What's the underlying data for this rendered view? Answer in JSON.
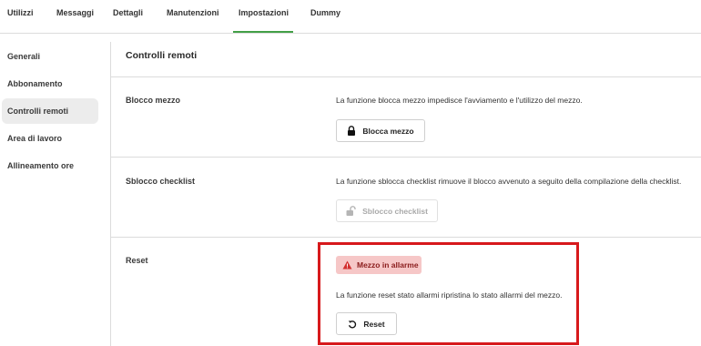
{
  "tabs": [
    {
      "label": "Utilizzi"
    },
    {
      "label": "Messaggi"
    },
    {
      "label": "Dettagli"
    },
    {
      "label": "Manutenzioni"
    },
    {
      "label": "Impostazioni"
    },
    {
      "label": "Dummy"
    }
  ],
  "active_tab": "Impostazioni",
  "sidebar": {
    "items": [
      {
        "label": "Generali"
      },
      {
        "label": "Abbonamento"
      },
      {
        "label": "Controlli remoti"
      },
      {
        "label": "Area di lavoro"
      },
      {
        "label": "Allineamento ore"
      }
    ],
    "active": "Controlli remoti"
  },
  "main": {
    "title": "Controlli remoti",
    "rows": [
      {
        "label": "Blocco mezzo",
        "description": "La funzione blocca mezzo impedisce l'avviamento e l'utilizzo del mezzo.",
        "button": "Blocca mezzo",
        "button_icon": "lock-icon"
      },
      {
        "label": "Sblocco checklist",
        "description": "La funzione sblocca checklist rimuove il blocco avvenuto a seguito della compilazione della checklist.",
        "button": "Sblocco checklist",
        "button_icon": "unlock-icon",
        "button_disabled": true
      },
      {
        "label": "Reset",
        "alert": "Mezzo in allarme",
        "alert_icon": "warning-icon",
        "description": "La funzione reset stato allarmi ripristina lo stato allarmi del mezzo.",
        "button": "Reset",
        "button_icon": "reset-icon"
      }
    ]
  },
  "colors": {
    "accent": "#43a047",
    "alert_bg": "#f6c7c7",
    "alert_text": "#8a1c1c",
    "alert_icon": "#d32f2f",
    "highlight": "#d7191c"
  }
}
